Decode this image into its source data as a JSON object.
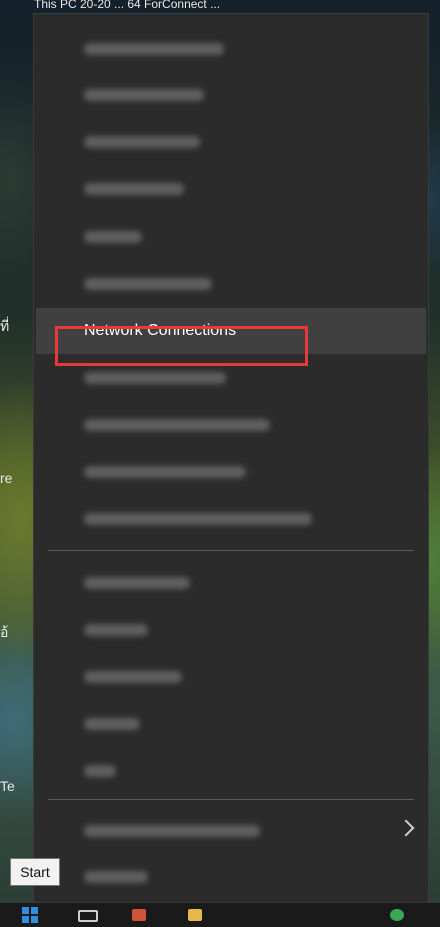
{
  "background": {
    "top_text": "This PC 20-20 ... 64 ForConnect ...",
    "edge_labels": [
      "ที่",
      "re",
      "อ้",
      "Te"
    ]
  },
  "menu": {
    "items_top": [
      {
        "label": "Apps and Features",
        "blurred": true
      },
      {
        "label": "Mobility Center",
        "blurred": true
      },
      {
        "label": "Power Options",
        "blurred": true
      },
      {
        "label": "Event Viewer",
        "blurred": true
      },
      {
        "label": "System",
        "blurred": true
      },
      {
        "label": "Device Manager",
        "blurred": true
      },
      {
        "label": "Network Connections",
        "blurred": false,
        "selected": true
      },
      {
        "label": "Disk Management",
        "blurred": true
      },
      {
        "label": "Computer Management",
        "blurred": true
      },
      {
        "label": "Windows PowerShell",
        "blurred": true
      },
      {
        "label": "Windows PowerShell (Admin)",
        "blurred": true
      }
    ],
    "items_mid": [
      {
        "label": "Task Manager",
        "blurred": true
      },
      {
        "label": "Settings",
        "blurred": true
      },
      {
        "label": "File Explorer",
        "blurred": true
      },
      {
        "label": "Search",
        "blurred": true
      },
      {
        "label": "Run",
        "blurred": true
      }
    ],
    "items_bottom": [
      {
        "label": "Shut down or sign out",
        "blurred": true,
        "has_submenu": true
      },
      {
        "label": "Desktop",
        "blurred": true
      }
    ],
    "highlight_color": "#e63a3a"
  },
  "tooltip": {
    "text": "Start"
  },
  "taskbar": {
    "icons": [
      "windows-logo-icon",
      "task-view-icon",
      "app-icon",
      "folder-icon",
      "chrome-icon"
    ]
  }
}
